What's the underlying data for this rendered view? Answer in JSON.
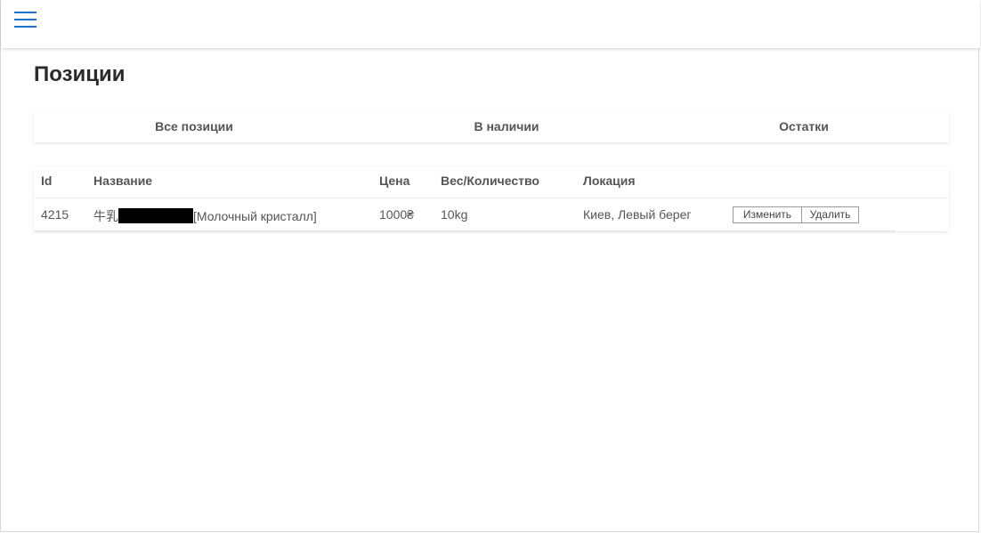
{
  "page": {
    "title": "Позиции"
  },
  "tabs": [
    {
      "label": "Все позиции"
    },
    {
      "label": "В наличии"
    },
    {
      "label": "Остатки"
    }
  ],
  "table": {
    "headers": {
      "id": "Id",
      "name": "Название",
      "price": "Цена",
      "weight": "Вес/Количество",
      "location": "Локация"
    },
    "rows": [
      {
        "id": "4215",
        "name_prefix": "牛乳",
        "name_suffix": "[Молочный кристалл]",
        "price": "1000₴",
        "weight": "10kg",
        "location": "Киев, Левый берег",
        "edit_label": "Изменить",
        "delete_label": "Удалить"
      }
    ]
  },
  "colors": {
    "accent": "#1a73c9",
    "text": "#555555",
    "title": "#2b2b2b"
  },
  "icons": {
    "menu": "hamburger-menu-icon"
  }
}
